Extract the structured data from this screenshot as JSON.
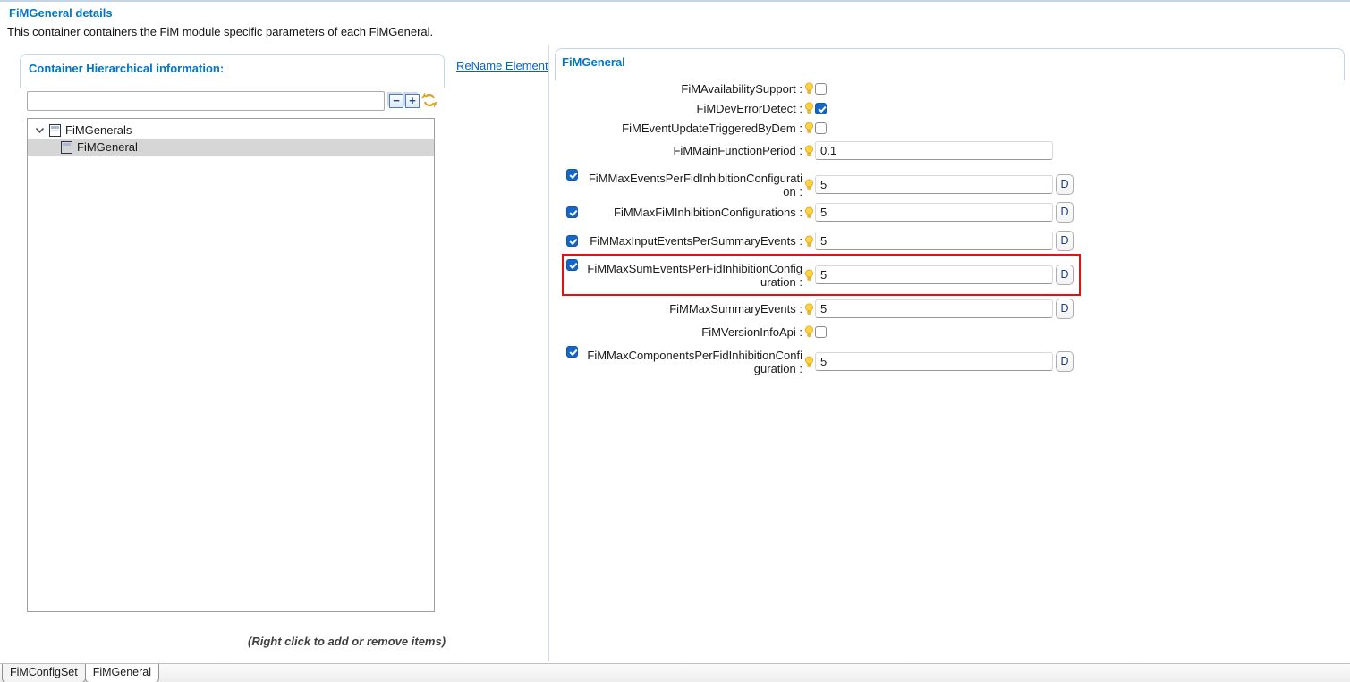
{
  "header": {
    "title": "FiMGeneral details",
    "description": "This container containers the FiM module specific parameters of each FiMGeneral."
  },
  "left_panel": {
    "title": "Container Hierarchical information:",
    "search": {
      "value": ""
    },
    "toolbar": {
      "collapse_glyph": "−",
      "expand_glyph": "+"
    },
    "tree": {
      "items": [
        {
          "label": "FiMGenerals",
          "level": 0,
          "expanded": true,
          "selected": false
        },
        {
          "label": "FiMGeneral",
          "level": 1,
          "expanded": false,
          "selected": true
        }
      ]
    },
    "hint": "(Right click to add or remove items)"
  },
  "rename_link": {
    "label": "ReName Element"
  },
  "right_panel": {
    "title": "FiMGeneral",
    "label_suffix": " :",
    "d_button_label": "D",
    "rows": [
      {
        "label": "FiMAvailabilitySupport",
        "control": "checkbox",
        "checked": false
      },
      {
        "label": "FiMDevErrorDetect",
        "control": "checkbox",
        "checked": true
      },
      {
        "label": "FiMEventUpdateTriggeredByDem",
        "control": "checkbox",
        "checked": false
      },
      {
        "label": "FiMMainFunctionPeriod",
        "control": "text",
        "value": "0.1",
        "default_button": false
      },
      {
        "label": "FiMMaxEventsPerFidInhibitionConfiguration",
        "control": "text",
        "value": "5",
        "enabled_checkbox": true,
        "default_button": true
      },
      {
        "label": "FiMMaxFiMInhibitionConfigurations",
        "control": "text",
        "value": "5",
        "enabled_checkbox": true,
        "default_button": true
      },
      {
        "label": "FiMMaxInputEventsPerSummaryEvents",
        "control": "text",
        "value": "5",
        "enabled_checkbox": true,
        "default_button": true
      },
      {
        "label": "FiMMaxSumEventsPerFidInhibitionConfiguration",
        "control": "text",
        "value": "5",
        "enabled_checkbox": true,
        "default_button": true,
        "highlighted": true
      },
      {
        "label": "FiMMaxSummaryEvents",
        "control": "text",
        "value": "5",
        "default_button": true
      },
      {
        "label": "FiMVersionInfoApi",
        "control": "checkbox",
        "checked": false
      },
      {
        "label": "FiMMaxComponentsPerFidInhibitionConfiguration",
        "control": "text",
        "value": "5",
        "enabled_checkbox": true,
        "default_button": true
      }
    ]
  },
  "tabs": [
    {
      "label": "FiMConfigSet",
      "active": false
    },
    {
      "label": "FiMGeneral",
      "active": true
    }
  ],
  "colors": {
    "accent_blue": "#0076C6",
    "link_blue": "#0563C1",
    "checkbox_checked": "#1466C8",
    "highlight_red": "#E01212",
    "selection_gray": "#D6D6D6"
  }
}
